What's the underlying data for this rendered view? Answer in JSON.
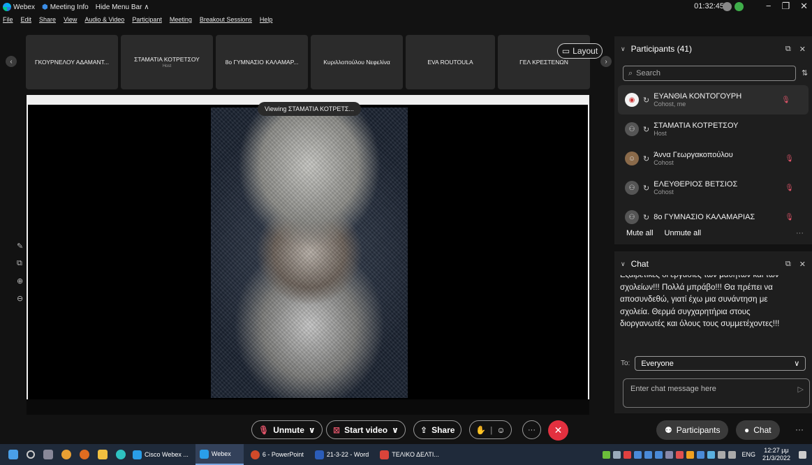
{
  "titlebar": {
    "app_name": "Webex",
    "meeting_info": "Meeting Info",
    "hide_menu_bar": "Hide Menu Bar ∧",
    "clock": "01:32:45",
    "min": "−",
    "restore": "❐",
    "close": "✕"
  },
  "menu": [
    "File",
    "Edit",
    "Share",
    "View",
    "Audio & Video",
    "Participant",
    "Meeting",
    "Breakout Sessions",
    "Help"
  ],
  "strip": {
    "tiles": [
      {
        "name": "ΓΚΟΥΡΝΕΛΟΥ ΑΔΑΜΑΝΤ...",
        "sub": ""
      },
      {
        "name": "ΣΤΑΜΑΤΙΑ ΚΟΤΡΕΤΣΟΥ",
        "sub": "Host"
      },
      {
        "name": "8ο ΓΥΜΝΑΣΙΟ ΚΑΛΑΜΑΡ...",
        "sub": ""
      },
      {
        "name": "Κυριλλοπούλου Νεφελίνα",
        "sub": ""
      },
      {
        "name": "EVA ROUTOULA",
        "sub": ""
      },
      {
        "name": "ΓΕΛ ΚΡΕΣΤΕΝΩΝ",
        "sub": ""
      }
    ],
    "layout_label": "Layout"
  },
  "stage": {
    "viewing_label": "Viewing ΣΤΑΜΑΤΙΑ ΚΟΤΡΕΤΣ..."
  },
  "participants": {
    "title": "Participants (41)",
    "search_placeholder": "Search",
    "items": [
      {
        "name": "ΕΥΑΝΘΙΑ ΚΟΝΤΟΓΟΥΡΗ",
        "role": "Cohost, me",
        "muted": true
      },
      {
        "name": "ΣΤΑΜΑΤΙΑ ΚΟΤΡΕΤΣΟΥ",
        "role": "Host",
        "muted": false
      },
      {
        "name": "Άννα Γεωργακοπούλου",
        "role": "Cohost",
        "muted": true
      },
      {
        "name": "ΕΛΕΥΘΕΡΙΟΣ ΒΕΤΣΙΟΣ",
        "role": "Cohost",
        "muted": true
      },
      {
        "name": "8ο ΓΥΜΝΑΣΙΟ ΚΑΛΑΜΑΡΙΑΣ",
        "role": "",
        "muted": true
      }
    ],
    "mute_all": "Mute all",
    "unmute_all": "Unmute all",
    "more": "···"
  },
  "chat": {
    "title": "Chat",
    "message_lines": [
      "Εξαιρετικές οι εργασίες των μαθητών και των",
      "σχολείων!!! Πολλά μπράβο!!! Θα πρέπει να",
      "αποσυνδεθώ, γιατί έχω μια συνάντηση με",
      "σχολεία.  Θερμά συγχαρητήρια στους",
      "διοργανωτές και όλους τους συμμετέχοντες!!!"
    ],
    "to_label": "To:",
    "to_value": "Everyone",
    "input_placeholder": "Enter chat message here"
  },
  "controls": {
    "unmute": "Unmute",
    "start_video": "Start video",
    "share": "Share",
    "participants": "Participants",
    "chat": "Chat",
    "more": "···"
  },
  "taskbar": {
    "apps": [
      "Cisco Webex ...",
      "Webex",
      "6 - PowerPoint",
      "21-3-22 - Word",
      "ΤΕΛΙΚΟ ΔΕΛΤΙ..."
    ],
    "lang": "ENG",
    "time": "12:27 μμ",
    "date": "21/3/2022"
  },
  "colors": {
    "accent_red": "#e3303f",
    "muted_red": "#e3556a",
    "panel_bg": "#1e1e1e",
    "app_bg": "#121212"
  }
}
